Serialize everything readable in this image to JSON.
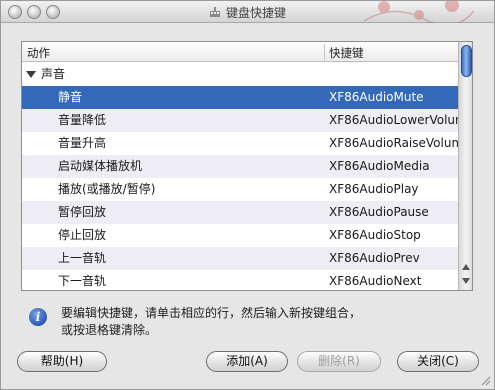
{
  "window": {
    "title": "键盘快捷键"
  },
  "tree": {
    "columns": [
      "动作",
      "快捷键"
    ],
    "group": {
      "label": "声音",
      "expanded": true
    },
    "rows": [
      {
        "action": "静音",
        "shortcut": "XF86AudioMute",
        "selected": true
      },
      {
        "action": "音量降低",
        "shortcut": "XF86AudioLowerVolum"
      },
      {
        "action": "音量升高",
        "shortcut": "XF86AudioRaiseVolum"
      },
      {
        "action": "启动媒体播放机",
        "shortcut": "XF86AudioMedia"
      },
      {
        "action": "播放(或播放/暂停)",
        "shortcut": "XF86AudioPlay"
      },
      {
        "action": "暂停回放",
        "shortcut": "XF86AudioPause"
      },
      {
        "action": "停止回放",
        "shortcut": "XF86AudioStop"
      },
      {
        "action": "上一音轨",
        "shortcut": "XF86AudioPrev"
      },
      {
        "action": "下一音轨",
        "shortcut": "XF86AudioNext"
      }
    ]
  },
  "info": {
    "icon": "info-icon",
    "text": "要编辑快捷键，请单击相应的行，然后输入新按键组合，或按退格键清除。"
  },
  "buttons": {
    "help": "帮助(H)",
    "add": "添加(A)",
    "remove": "删除(R)",
    "close": "关闭(C)"
  },
  "colors": {
    "selection": "#3369b8",
    "alt_row": "#ededf3",
    "scroll_thumb": "#3c6fc4"
  }
}
